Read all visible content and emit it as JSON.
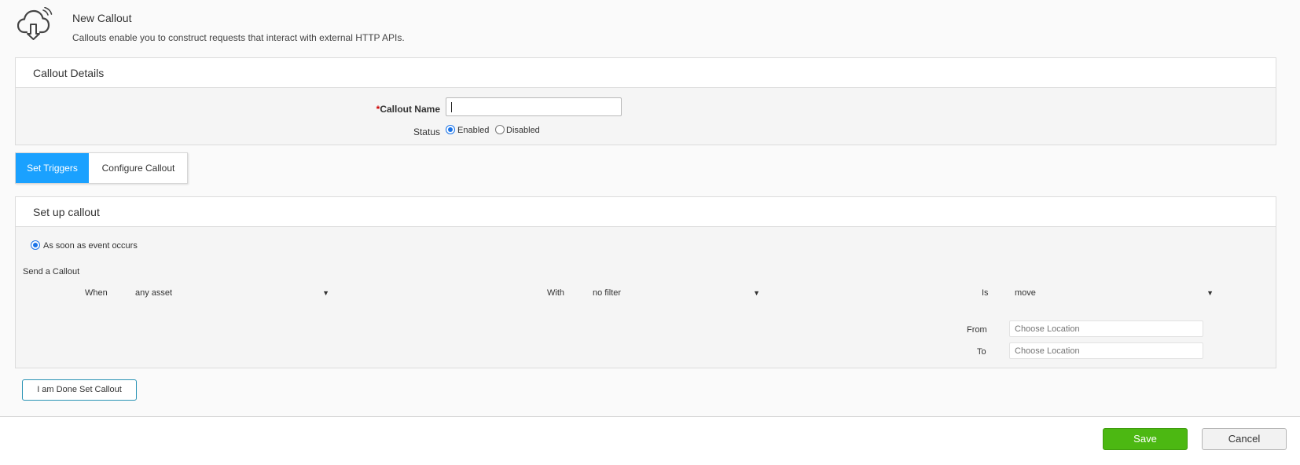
{
  "header": {
    "icon": "cloud-download-icon",
    "title": "New Callout",
    "subtitle": "Callouts enable you to construct requests that interact with external HTTP APIs."
  },
  "details": {
    "title": "Callout Details",
    "name_required_mark": "*",
    "name_label": "Callout Name",
    "name_value": "",
    "status_label": "Status",
    "status_options": [
      "Enabled",
      "Disabled"
    ],
    "status_selected": "Enabled"
  },
  "tabs": [
    {
      "label": "Set Triggers",
      "active": true
    },
    {
      "label": "Configure Callout",
      "active": false
    }
  ],
  "setup": {
    "title": "Set up callout",
    "trigger_option": "As soon as event occurs",
    "send_label": "Send a Callout",
    "when_label": "When",
    "when_value": "any asset",
    "with_label": "With",
    "with_value": "no filter",
    "is_label": "Is",
    "is_value": "move",
    "from_label": "From",
    "from_placeholder": "Choose Location",
    "to_label": "To",
    "to_placeholder": "Choose Location"
  },
  "buttons": {
    "done": "I am Done Set Callout",
    "save": "Save",
    "cancel": "Cancel"
  },
  "colors": {
    "accent": "#1aa1ff",
    "save": "#4cb812",
    "done_border": "#2a93b5"
  }
}
